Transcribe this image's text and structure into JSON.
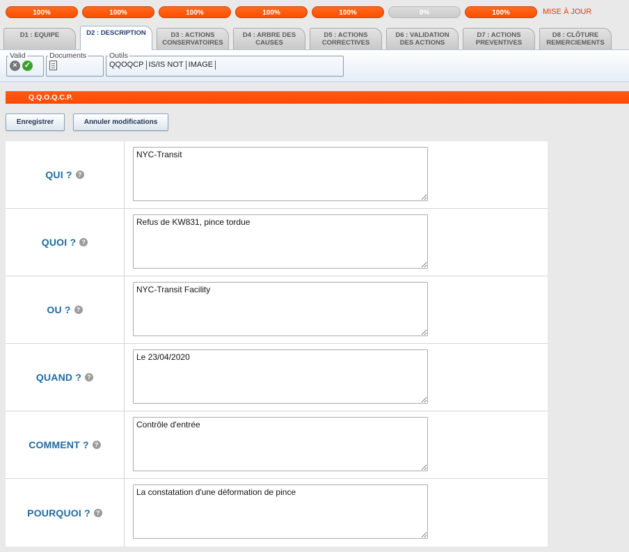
{
  "progress": [
    {
      "label": "100%",
      "state": "done"
    },
    {
      "label": "100%",
      "state": "done"
    },
    {
      "label": "100%",
      "state": "done"
    },
    {
      "label": "100%",
      "state": "done"
    },
    {
      "label": "100%",
      "state": "done"
    },
    {
      "label": "0%",
      "state": "empty"
    },
    {
      "label": "100%",
      "state": "done"
    }
  ],
  "update_label": "MISE À JOUR",
  "tabs": [
    {
      "line1": "D1 : EQUIPE",
      "line2": ""
    },
    {
      "line1": "D2 : DESCRIPTION",
      "line2": ""
    },
    {
      "line1": "D3 : ACTIONS",
      "line2": "CONSERVATOIRES"
    },
    {
      "line1": "D4 : ARBRE DES",
      "line2": "CAUSES"
    },
    {
      "line1": "D5 : ACTIONS",
      "line2": "CORRECTIVES"
    },
    {
      "line1": "D6 : VALIDATION",
      "line2": "DES ACTIONS"
    },
    {
      "line1": "D7 : ACTIONS",
      "line2": "PREVENTIVES"
    },
    {
      "line1": "D8 : CLÔTURE",
      "line2": "REMERCIEMENTS"
    }
  ],
  "toolbar": {
    "valid_legend": "Valid",
    "documents_legend": "Documents",
    "outils_legend": "Outils",
    "tools": [
      "QQOQCP",
      "IS/IS NOT",
      "IMAGE"
    ],
    "icons": {
      "reject": "x-circle-icon",
      "accept": "check-circle-icon",
      "document": "document-icon"
    }
  },
  "section_title": "Q.Q.O.Q.C.P.",
  "buttons": {
    "save": "Enregistrer",
    "cancel": "Annuler modifications"
  },
  "fields": [
    {
      "label": "QUI ?",
      "value": "NYC-Transit"
    },
    {
      "label": "QUOI ?",
      "value": "Refus de KW831, pince tordue"
    },
    {
      "label": "OU ?",
      "value": "NYC-Transit Facility"
    },
    {
      "label": "QUAND ?",
      "value": "Le 23/04/2020"
    },
    {
      "label": "COMMENT ?",
      "value": "Contrôle d'entrée"
    },
    {
      "label": "POURQUOI ?",
      "value": "La constatation d'une déformation de pince"
    }
  ],
  "colors": {
    "accent": "#ff5000",
    "label_blue": "#1d6aa3",
    "update_red": "#e23a00"
  }
}
